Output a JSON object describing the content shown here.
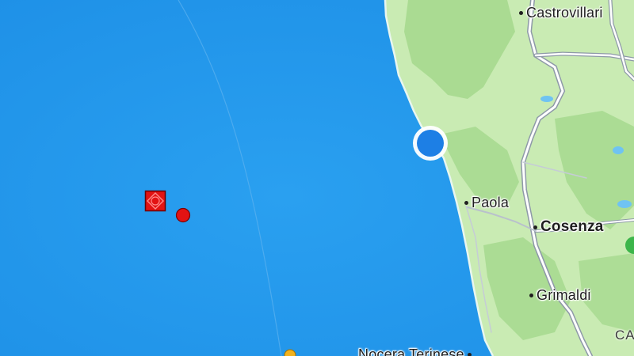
{
  "map": {
    "colors": {
      "sea": "#2196ec",
      "land": "#c7eab0",
      "forest": "#a5d98d",
      "road": "#8a96a6",
      "location": "#1d7fe5",
      "quake_marker": "#e21313"
    },
    "cities": [
      {
        "name": "Castrovillari",
        "rank": "minor"
      },
      {
        "name": "Paola",
        "rank": "minor"
      },
      {
        "name": "Cosenza",
        "rank": "major"
      },
      {
        "name": "Grimaldi",
        "rank": "minor"
      },
      {
        "name": "Nocera Terinese",
        "rank": "minor"
      }
    ],
    "edge_label": "CA",
    "markers": {
      "current_location": "blue-dot",
      "epicenter": "red-square",
      "earthquake": "red-circle",
      "partial": "orange-circle"
    }
  }
}
